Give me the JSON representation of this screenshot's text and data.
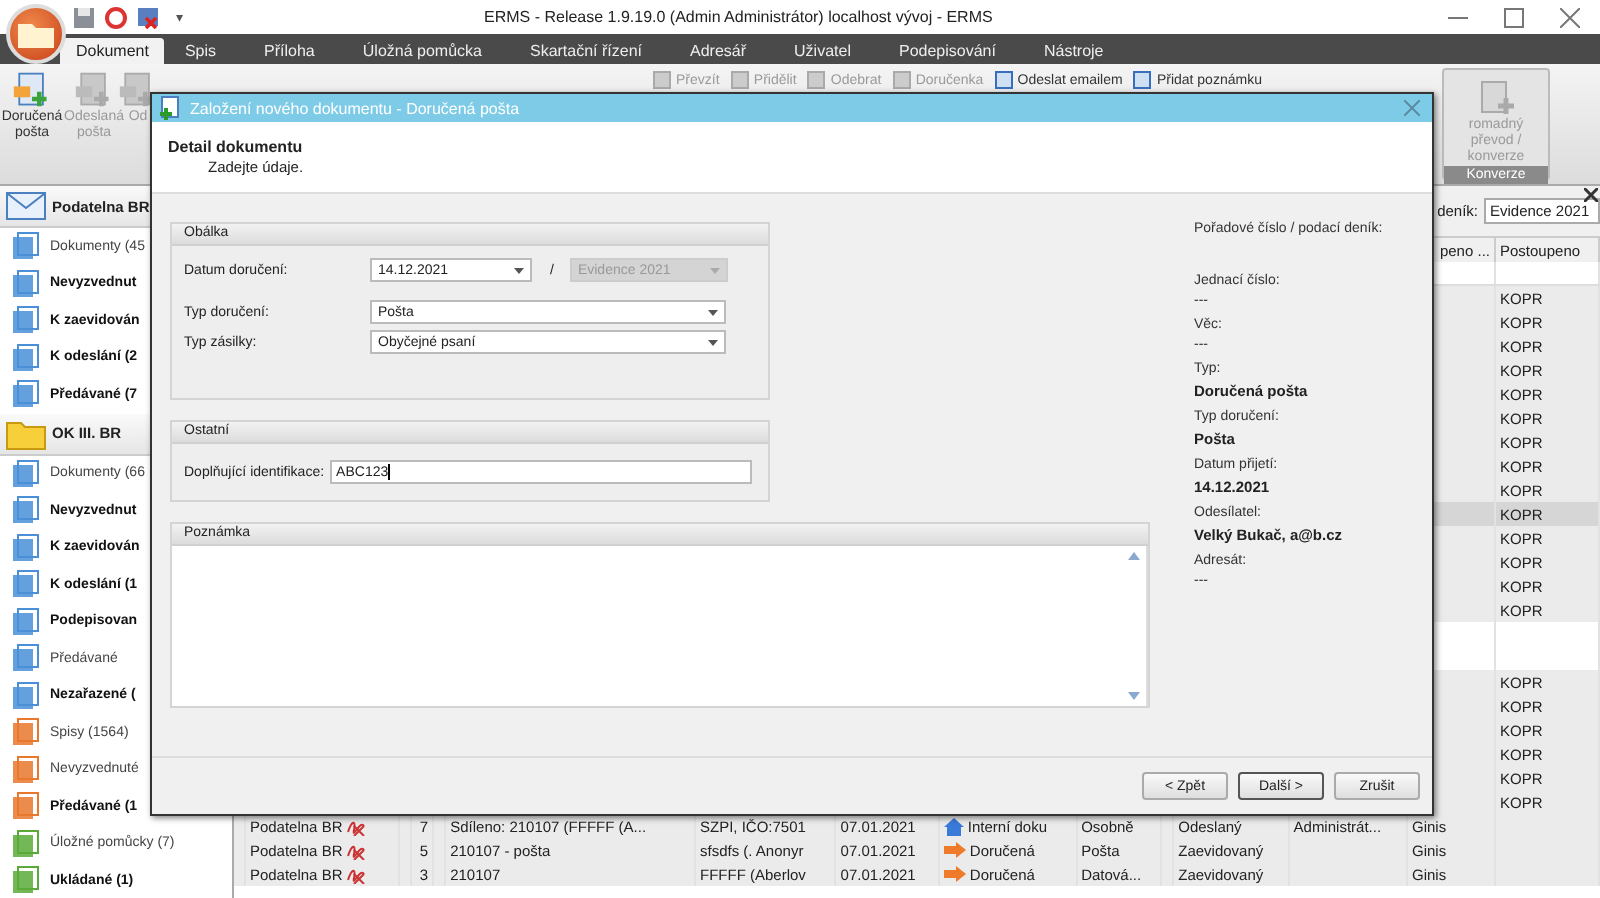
{
  "window": {
    "title": "ERMS - Release 1.9.19.0 (Admin Administrátor) localhost vývoj - ERMS",
    "quick_menu": "▾"
  },
  "menu_tabs": [
    {
      "label": "Dokument",
      "selected": true
    },
    {
      "label": "Spis",
      "selected": false
    },
    {
      "label": "Příloha",
      "selected": false
    },
    {
      "label": "Úložná pomůcka",
      "selected": false
    },
    {
      "label": "Skartační řízení",
      "selected": false
    },
    {
      "label": "Adresář",
      "selected": false
    },
    {
      "label": "Uživatel",
      "selected": false
    },
    {
      "label": "Podepisování",
      "selected": false
    },
    {
      "label": "Nástroje",
      "selected": false
    }
  ],
  "ribbon": {
    "big_buttons": [
      {
        "label": "Doručená pošta",
        "disabled": false
      },
      {
        "label": "Odeslaná pošta",
        "disabled": true
      },
      {
        "label": "Od",
        "disabled": true
      }
    ],
    "small_buttons": [
      {
        "label": "Převzít",
        "disabled": true
      },
      {
        "label": "Přidělit",
        "disabled": true
      },
      {
        "label": "Odebrat",
        "disabled": true
      },
      {
        "label": "Doručenka",
        "disabled": true
      },
      {
        "label": "Odeslat emailem",
        "disabled": false
      },
      {
        "label": "Přidat poznámku",
        "disabled": false
      }
    ],
    "conversion": {
      "button": "romadný převod / konverze",
      "group": "Konverze"
    }
  },
  "sidebar": [
    {
      "title": "Podatelna BR",
      "kind": "mail",
      "items": [
        {
          "label": "Dokumenty (45",
          "unread": false,
          "kind": "document"
        },
        {
          "label": "Nevyzvednut",
          "unread": true,
          "kind": "document"
        },
        {
          "label": "K zaevidován",
          "unread": true,
          "kind": "document"
        },
        {
          "label": "K odeslání (2",
          "unread": true,
          "kind": "document"
        },
        {
          "label": "Předávané (7",
          "unread": true,
          "kind": "document"
        }
      ]
    },
    {
      "title": "OK III. BR",
      "kind": "folder",
      "items": [
        {
          "label": "Dokumenty (66",
          "unread": false,
          "kind": "document"
        },
        {
          "label": "Nevyzvednut",
          "unread": true,
          "kind": "document"
        },
        {
          "label": "K zaevidován",
          "unread": true,
          "kind": "document"
        },
        {
          "label": "K odeslání (1",
          "unread": true,
          "kind": "document"
        },
        {
          "label": "Podepisovan",
          "unread": true,
          "kind": "document"
        },
        {
          "label": "Předávané",
          "unread": false,
          "kind": "document"
        },
        {
          "label": "Nezařazené (",
          "unread": true,
          "kind": "document"
        },
        {
          "label": "Spisy (1564)",
          "unread": false,
          "kind": "file"
        },
        {
          "label": "Nevyzvednuté",
          "unread": false,
          "kind": "file"
        },
        {
          "label": "Předávané (1",
          "unread": true,
          "kind": "file"
        },
        {
          "label": "Úložné pomůcky (7)",
          "unread": false,
          "kind": "storage"
        },
        {
          "label": "Ukládané (1)",
          "unread": true,
          "kind": "storage"
        }
      ]
    }
  ],
  "grid": {
    "register_label": "deník:",
    "register_value": "Evidence 2021",
    "columns": {
      "column_14": "peno ...",
      "column_15": "Postoupeno"
    },
    "rows": [
      {
        "column_15": "KOPR",
        "selected": false
      },
      {
        "column_15": "KOPR",
        "selected": false
      },
      {
        "column_15": "KOPR",
        "selected": false
      },
      {
        "column_15": "KOPR",
        "selected": false
      },
      {
        "column_15": "KOPR",
        "selected": false
      },
      {
        "column_15": "KOPR",
        "selected": false
      },
      {
        "column_15": "KOPR",
        "selected": false
      },
      {
        "column_15": "KOPR",
        "selected": false
      },
      {
        "column_15": "KOPR",
        "selected": false
      },
      {
        "column_15": "KOPR",
        "selected": true
      },
      {
        "column_15": "KOPR",
        "selected": false
      },
      {
        "column_15": "KOPR",
        "selected": false
      },
      {
        "column_15": "KOPR",
        "selected": false
      },
      {
        "column_15": "KOPR",
        "selected": false
      },
      {
        "selected": false
      },
      {
        "selected": false
      },
      {
        "column_15": "KOPR",
        "selected": false
      },
      {
        "column_15": "KOPR",
        "selected": false
      },
      {
        "column_15": "KOPR",
        "selected": false
      },
      {
        "column_15": "KOPR",
        "selected": false
      },
      {
        "column_15": "KOPR",
        "selected": false
      },
      {
        "column_15": "KOPR",
        "selected": false
      },
      {
        "column_2": "Podatelna BR",
        "column_4": "7",
        "column_6": "Sdíleno: 210107 (FFFFF (A...",
        "column_7": "SZPI, IČO:7501",
        "column_8": "07.01.2021",
        "column_9": "Interní doku",
        "kind": "internal",
        "column_10": "Osobně",
        "column_12": "Odeslaný",
        "column_13": "Administrát...",
        "column_14": "Ginis",
        "selected": false
      },
      {
        "column_2": "Podatelna BR",
        "column_4": "5",
        "column_6": "210107 - pošta",
        "column_7": "sfsdfs (. Anonyr",
        "column_8": "07.01.2021",
        "column_9": "Doručená",
        "kind": "received",
        "column_10": "Pošta",
        "column_12": "Zaevidovaný",
        "column_14": "Ginis",
        "selected": false
      },
      {
        "column_2": "Podatelna BR",
        "column_4": "3",
        "column_6": "210107",
        "column_7": "FFFFF (Aberlov",
        "column_8": "07.01.2021",
        "column_9": "Doručená",
        "kind": "received",
        "column_10": "Datová...",
        "column_12": "Zaevidovaný",
        "column_14": "Ginis",
        "selected": false
      }
    ]
  },
  "dialog": {
    "title": "Založení nového dokumentu - Doručená pošta",
    "heading": "Detail dokumentu",
    "subheading": "Zadejte údaje.",
    "envelope": {
      "title": "Obálka",
      "date_label": "Datum doručení:",
      "date_value": "14.12.2021",
      "separator": "/",
      "register": {
        "value": "Evidence 2021",
        "disabled": true
      },
      "fields": [
        {
          "label": "Typ doručení:",
          "value": "Pošta"
        },
        {
          "label": "Typ zásilky:",
          "value": "Obyčejné psaní"
        }
      ]
    },
    "other": {
      "title": "Ostatní",
      "label": "Doplňující identifikace:",
      "value": "ABC123",
      "focused": true
    },
    "note": {
      "title": "Poznámka"
    },
    "summary": [
      {
        "label": "Pořadové číslo / podací deník:"
      },
      {
        "label": "Jednací číslo:",
        "value": "---",
        "bold": false
      },
      {
        "label": "Věc:",
        "value": "---",
        "bold": false
      },
      {
        "label": "Typ:",
        "value": "Doručená pošta",
        "bold": true
      },
      {
        "label": "Typ doručení:",
        "value": "Pošta",
        "bold": true
      },
      {
        "label": "Datum přijetí:",
        "value": "14.12.2021",
        "bold": true
      },
      {
        "label": "Odesílatel:",
        "value": "Velký Bukač, a@b.cz",
        "bold": true
      },
      {
        "label": "Adresát:",
        "value": "---",
        "bold": false
      }
    ],
    "buttons": [
      {
        "label": "< Zpět",
        "default": false
      },
      {
        "label": "Další >",
        "default": true
      },
      {
        "label": "Zrušit",
        "default": false
      }
    ]
  }
}
